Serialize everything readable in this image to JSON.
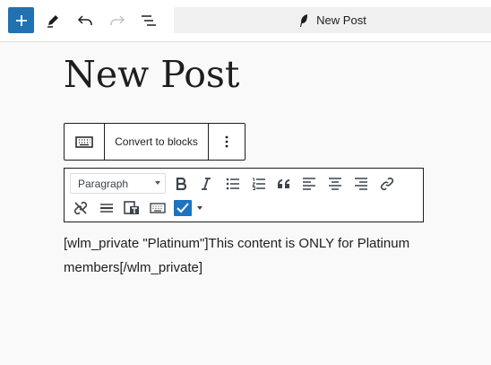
{
  "header": {
    "add_block_icon": "plus-icon",
    "tools_icon": "pencil-icon",
    "undo_icon": "undo-icon",
    "redo_icon": "redo-icon",
    "document_overview_icon": "list-view-icon",
    "document_title": "New Post",
    "document_icon": "quill-icon"
  },
  "post": {
    "title": "New Post"
  },
  "block_toolbar": {
    "keyboard_icon": "keyboard-icon",
    "convert_label": "Convert to blocks",
    "more_icon": "more-vertical-icon"
  },
  "classic_toolbar": {
    "format_select": "Paragraph",
    "buttons": [
      "bold",
      "italic",
      "bulleted-list",
      "numbered-list",
      "blockquote",
      "align-left",
      "align-center",
      "align-right",
      "insert-link",
      "remove-link",
      "horizontal-line",
      "paste-as-text",
      "keyboard-shortcuts",
      "text-color"
    ],
    "text_color": "#1e73be"
  },
  "content": {
    "text": "[wlm_private \"Platinum\"]This content is ONLY for Platinum members[/wlm_private]"
  },
  "colors": {
    "accent": "#2271b1",
    "text": "#1e1e1e",
    "canvas": "#f9f9f9"
  }
}
